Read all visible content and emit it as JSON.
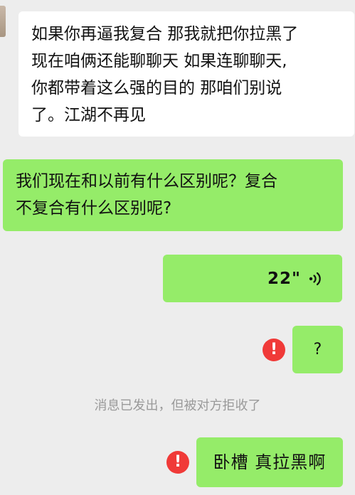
{
  "chat": {
    "messages": [
      {
        "side": "left",
        "text_lines": [
          "如果你再逼我复合  那我就把你拉黑了",
          "现在咱俩还能聊聊天 如果连聊聊天,",
          "你都带着这么强的目的 那咱们别说",
          "了。江湖不再见"
        ]
      },
      {
        "side": "right",
        "text_lines": [
          "我们现在和以前有什么区别呢？复合",
          "不复合有什么区别呢?"
        ]
      },
      {
        "side": "right",
        "type": "voice",
        "duration": "22\""
      },
      {
        "side": "right",
        "text": "?",
        "failed": true
      },
      {
        "side": "right",
        "text": "卧槽 真拉黑啊",
        "failed": true
      }
    ],
    "system_notice": "消息已发出，但被对方拒收了",
    "fail_icon_glyph": "!",
    "colors": {
      "background": "#ededed",
      "incoming_bubble": "#ffffff",
      "outgoing_bubble": "#95ec69",
      "fail_icon": "#f03a38",
      "notice_text": "#9a9a9a"
    },
    "icons": {
      "voice": "voice-wave-icon",
      "fail": "exclamation-circle-icon"
    }
  }
}
